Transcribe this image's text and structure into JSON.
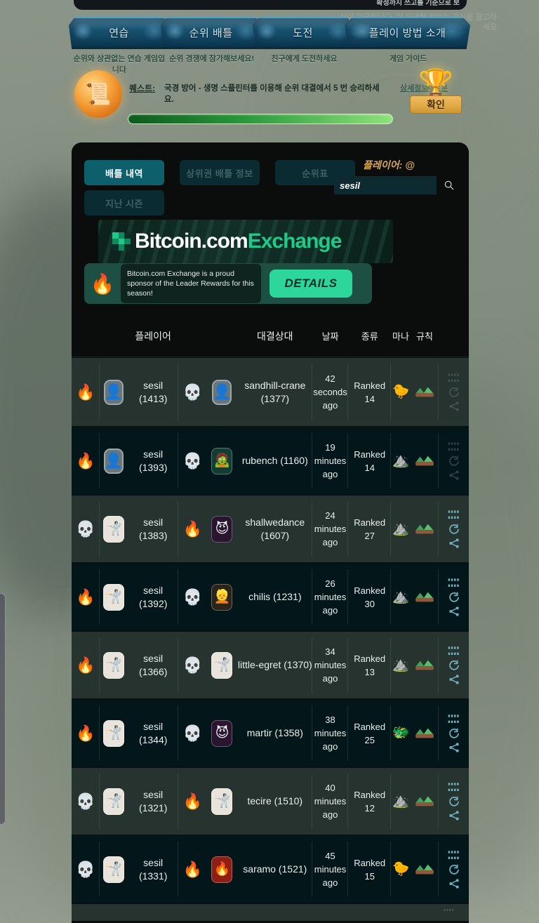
{
  "top_tooltip": {
    "clipped_text": "확정까지 쓰고를 기준으로 보",
    "ghost_lines": "상이 지급됩니다. 더 자세한 정보는 공식을 참고하세요"
  },
  "nav": {
    "items": [
      {
        "label": "연습",
        "sub": "순위와 상관없는 연습 게임입니다"
      },
      {
        "label": "순위 배틀",
        "sub": "순위 경쟁에 참가해보세요!"
      },
      {
        "label": "도전",
        "sub": "친구에게 도전하세요"
      },
      {
        "label": "플레이 방법 소개",
        "sub": "게임 가이드"
      }
    ]
  },
  "quest": {
    "label": "퀘스트:",
    "text": "국경 방어 - 생명 스플린터를 이용해 순위 대결에서 5 번 승리하세요.",
    "links": [
      "상세정보",
      "새로운 퀘스트"
    ],
    "orb_icon": "scroll-icon",
    "chest_icon": "treasure-chest-icon",
    "confirm_label": "확인",
    "progress_percent": 100
  },
  "tabs": {
    "row1": [
      {
        "label": "배틀 내역",
        "active": true
      },
      {
        "label": "상위권 배틀 정보",
        "active": false
      },
      {
        "label": "순위표",
        "active": false
      }
    ],
    "row2": [
      {
        "label": "지난 시즌",
        "active": false
      }
    ]
  },
  "search": {
    "label": "플레이어: @",
    "value": "sesil",
    "placeholder": "sesil",
    "icon": "search-icon"
  },
  "banner": {
    "title_white": "Bitcoin.com",
    "title_green": "Exchange",
    "message": "Bitcoin.com Exchange is a proud sponsor of the Leader Rewards for this season!",
    "cta_label": "DETAILS",
    "mascot_icon": "sponsor-mascot-icon",
    "accent_green": "#2dd69a"
  },
  "table": {
    "headers": [
      "플레이어",
      "대결상대",
      "날짜",
      "종류",
      "마나",
      "규칙"
    ],
    "rows": [
      {
        "result": "win",
        "player": "sesil (1413)",
        "player_avatar": "generic-avatar-icon",
        "opp_result": "loss",
        "opponent": "sandhill-crane (1377)",
        "opp_avatar": "generic-avatar-icon",
        "date": "42 seconds ago",
        "type": "Ranked 14",
        "mana_icon": "life-splinter-icon",
        "rule_icon": "ruleset-icon",
        "actions_dim": true
      },
      {
        "result": "win",
        "player": "sesil (1393)",
        "player_avatar": "generic-avatar-icon",
        "opp_result": "loss",
        "opponent": "rubench (1160)",
        "opp_avatar": "green-face-avatar-icon",
        "date": "19 minutes ago",
        "type": "Ranked 14",
        "mana_icon": "earth-splinter-icon",
        "rule_icon": "ruleset-icon",
        "actions_dim": true
      },
      {
        "result": "loss",
        "player": "sesil (1383)",
        "player_avatar": "knight-avatar-icon",
        "opp_result": "win",
        "opponent": "shallwedance (1607)",
        "opp_avatar": "purple-beast-avatar-icon",
        "date": "24 minutes ago",
        "type": "Ranked 27",
        "mana_icon": "earth-splinter-icon",
        "rule_icon": "ruleset-icon",
        "actions_dim": false
      },
      {
        "result": "win",
        "player": "sesil (1392)",
        "player_avatar": "knight-avatar-icon",
        "opp_result": "loss",
        "opponent": "chilis (1231)",
        "opp_avatar": "blonde-avatar-icon",
        "date": "26 minutes ago",
        "type": "Ranked 30",
        "mana_icon": "earth-splinter-icon",
        "rule_icon": "ruleset-icon",
        "actions_dim": false
      },
      {
        "result": "win",
        "player": "sesil (1366)",
        "player_avatar": "knight-avatar-icon",
        "opp_result": "loss",
        "opponent": "little-egret (1370)",
        "opp_avatar": "knight-avatar-icon",
        "date": "34 minutes ago",
        "type": "Ranked 13",
        "mana_icon": "earth-splinter-icon",
        "rule_icon": "ruleset-icon",
        "actions_dim": false
      },
      {
        "result": "win",
        "player": "sesil (1344)",
        "player_avatar": "knight-avatar-icon",
        "opp_result": "loss",
        "opponent": "martir (1358)",
        "opp_avatar": "purple-beast-avatar-icon",
        "date": "38 minutes ago",
        "type": "Ranked 25",
        "mana_icon": "green-monster-icon",
        "rule_icon": "ruleset-icon",
        "actions_dim": false
      },
      {
        "result": "loss",
        "player": "sesil (1321)",
        "player_avatar": "knight-avatar-icon",
        "opp_result": "win",
        "opponent": "tecire (1510)",
        "opp_avatar": "knight-avatar-icon",
        "date": "40 minutes ago",
        "type": "Ranked 12",
        "mana_icon": "earth-splinter-icon",
        "rule_icon": "ruleset-icon",
        "actions_dim": false
      },
      {
        "result": "loss",
        "player": "sesil (1331)",
        "player_avatar": "knight-avatar-icon",
        "opp_result": "win",
        "opponent": "saramo (1521)",
        "opp_avatar": "fire-avatar-icon",
        "date": "45 minutes ago",
        "type": "Ranked 15",
        "mana_icon": "life-splinter-icon",
        "rule_icon": "ruleset-icon",
        "actions_dim": false
      }
    ]
  },
  "colors": {
    "page_bg": "#838f80",
    "card_bg": "#0b0d0d",
    "row_even": "#26332f",
    "row_odd": "#03171a",
    "tab_active": "#0d5f6b",
    "tab_idle": "#0a2b31",
    "accent_gold": "#d9a85a",
    "action_teal": "#5e9aa8"
  }
}
